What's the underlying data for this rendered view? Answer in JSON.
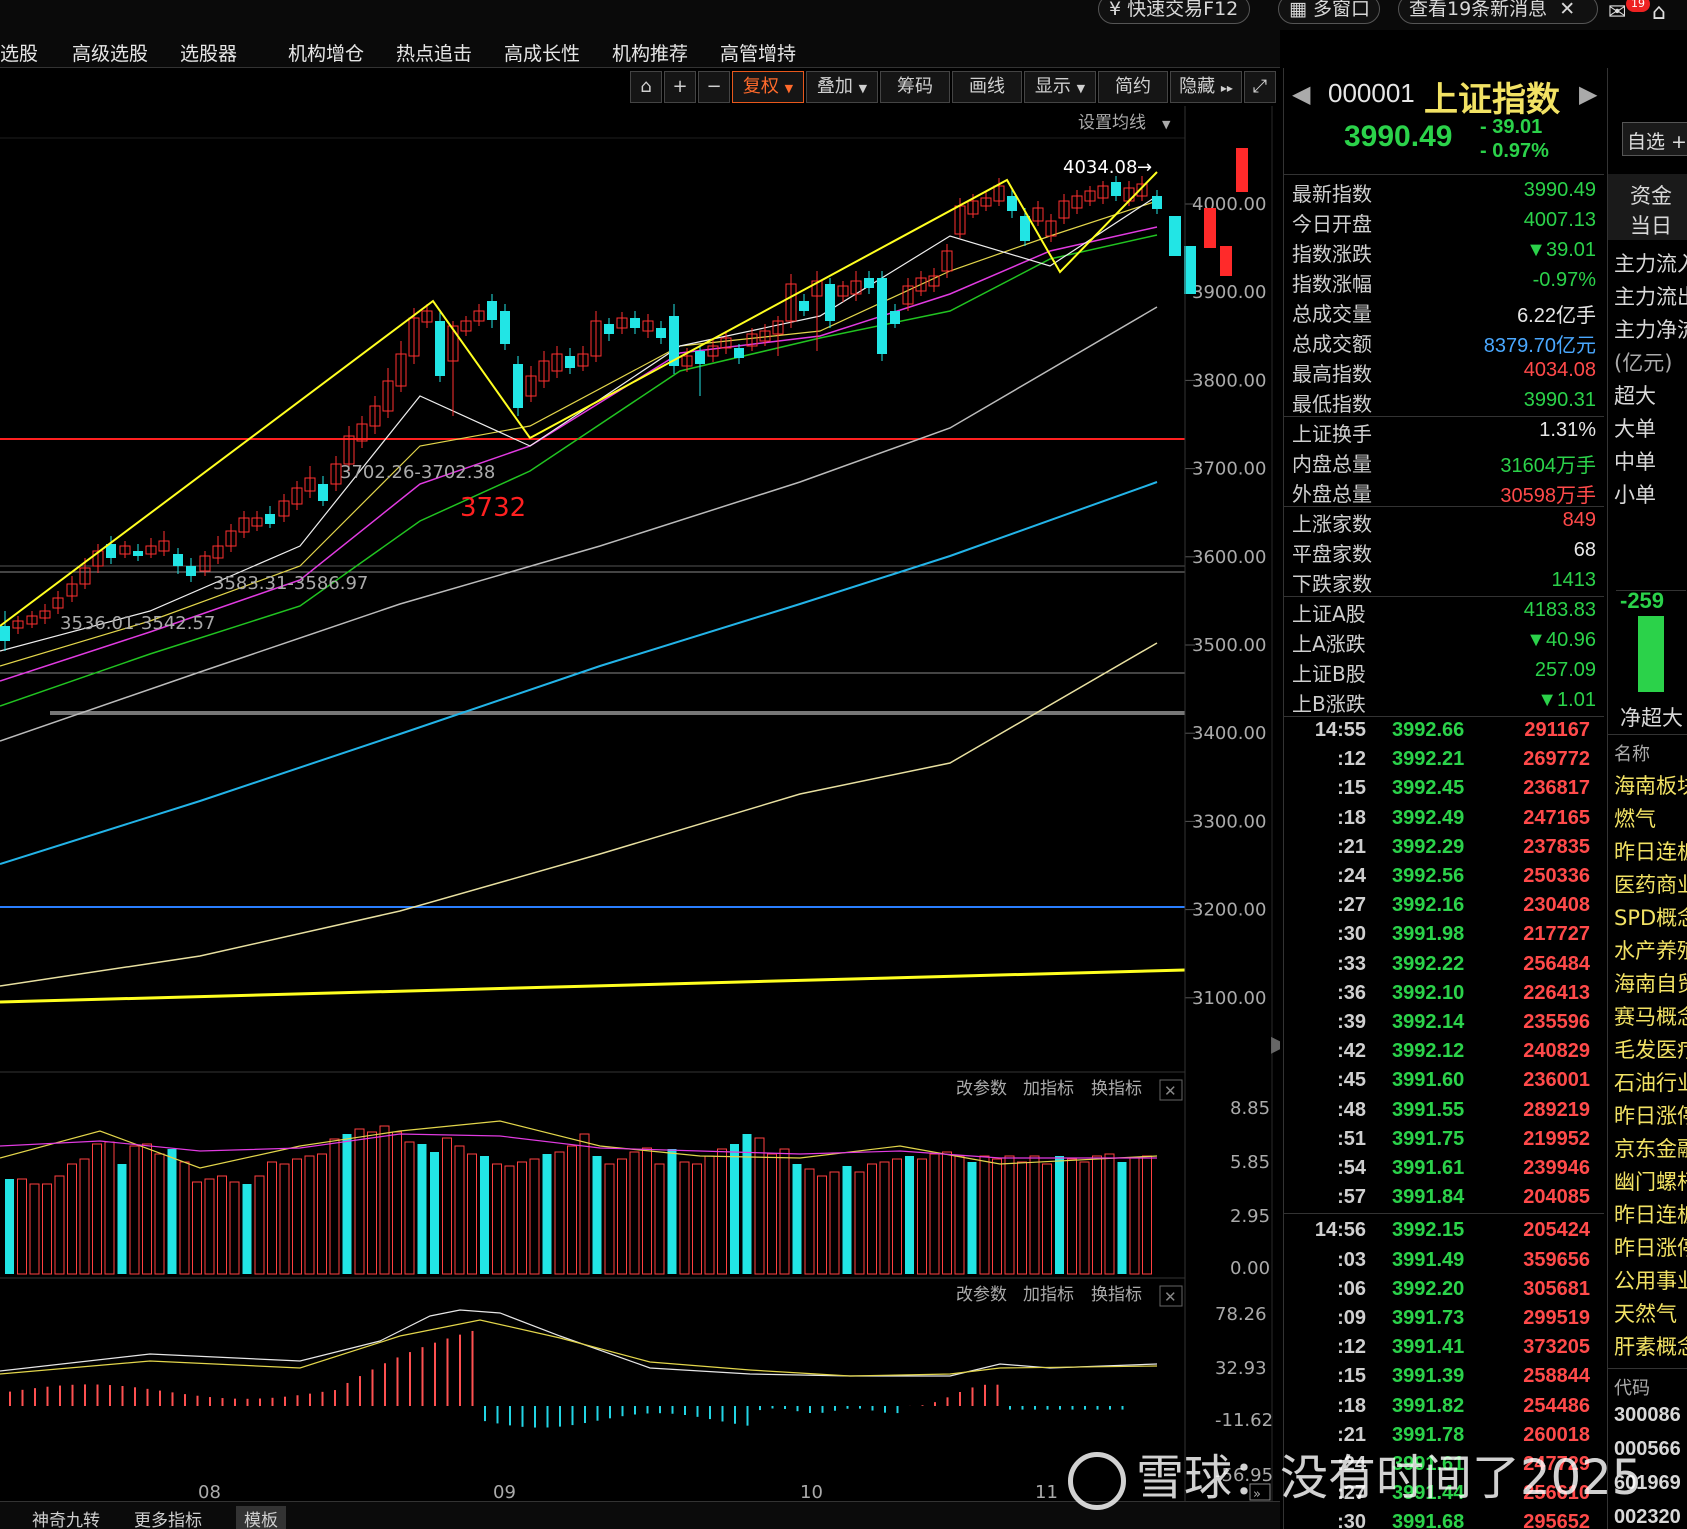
{
  "topbar": {
    "quick_trade": "快速交易F12",
    "multi_window": "多窗口",
    "news": "查看19条新消息",
    "mail_badge": "19"
  },
  "menu": [
    "选股",
    "高级选股",
    "选股器",
    "机构增仓",
    "热点追击",
    "高成长性",
    "机构推荐",
    "高管增持"
  ],
  "toolbar": {
    "restore_rights": "复权",
    "overlay": "叠加",
    "chips": "筹码",
    "draw": "画线",
    "display": "显示",
    "simple": "简约",
    "hide": "隐藏",
    "set_ma": "设置均线"
  },
  "chart": {
    "price_ticks": [
      "4000.00",
      "3900.00",
      "3800.00",
      "3700.00",
      "3600.00",
      "3500.00",
      "3400.00",
      "3300.00",
      "3200.00",
      "3100.00"
    ],
    "high_label": "4034.08",
    "annotations": {
      "a1": "3702.26-3702.38",
      "a2": "3583.31-3586.97",
      "a3": "3536.01-3542.57",
      "support": "3732"
    },
    "month_labels": [
      "08",
      "09",
      "10",
      "11"
    ],
    "volume_ticks": [
      "8.85",
      "5.85",
      "2.95",
      "0.00"
    ],
    "osc_ticks": [
      "78.26",
      "32.93",
      "-11.62",
      "-56.95"
    ],
    "panel_buttons": [
      "改参数",
      "加指标",
      "换指标"
    ]
  },
  "quote": {
    "code": "000001",
    "name": "上证指数",
    "price": "3990.49",
    "change": "- 39.01",
    "change_pct": "- 0.97%",
    "watch": "自选",
    "rows": [
      {
        "k": "最新指数",
        "v": "3990.49",
        "c": "#2bd24a"
      },
      {
        "k": "今日开盘",
        "v": "4007.13",
        "c": "#2bd24a"
      },
      {
        "k": "指数涨跌",
        "v": "▼39.01",
        "c": "#2bd24a"
      },
      {
        "k": "指数涨幅",
        "v": "-0.97%",
        "c": "#2bd24a"
      },
      {
        "k": "总成交量",
        "v": "6.22亿手",
        "c": "#e6e6e6"
      },
      {
        "k": "总成交额",
        "v": "8379.70亿元",
        "c": "#4aa8ff"
      },
      {
        "k": "最高指数",
        "v": "4034.08",
        "c": "#ff4a4a"
      },
      {
        "k": "最低指数",
        "v": "3990.31",
        "c": "#2bd24a"
      },
      {
        "k": "上证换手",
        "v": "1.31%",
        "c": "#e6e6e6"
      },
      {
        "k": "内盘总量",
        "v": "31604万手",
        "c": "#2bd24a"
      },
      {
        "k": "外盘总量",
        "v": "30598万手",
        "c": "#ff4a4a"
      },
      {
        "k": "上涨家数",
        "v": "849",
        "c": "#ff4a4a"
      },
      {
        "k": "平盘家数",
        "v": "68",
        "c": "#e6e6e6"
      },
      {
        "k": "下跌家数",
        "v": "1413",
        "c": "#2bd24a"
      },
      {
        "k": "上证A股",
        "v": "4183.83",
        "c": "#2bd24a"
      },
      {
        "k": "上A涨跌",
        "v": "▼40.96",
        "c": "#2bd24a"
      },
      {
        "k": "上证B股",
        "v": "257.09",
        "c": "#2bd24a"
      },
      {
        "k": "上B涨跌",
        "v": "▼1.01",
        "c": "#2bd24a"
      }
    ]
  },
  "ticks": [
    {
      "t": "14:55",
      "p": "3992.66",
      "q": "291167"
    },
    {
      "t": ":12",
      "p": "3992.21",
      "q": "269772"
    },
    {
      "t": ":15",
      "p": "3992.45",
      "q": "236817"
    },
    {
      "t": ":18",
      "p": "3992.49",
      "q": "247165"
    },
    {
      "t": ":21",
      "p": "3992.29",
      "q": "237835"
    },
    {
      "t": ":24",
      "p": "3992.56",
      "q": "250336"
    },
    {
      "t": ":27",
      "p": "3992.16",
      "q": "230408"
    },
    {
      "t": ":30",
      "p": "3991.98",
      "q": "217727"
    },
    {
      "t": ":33",
      "p": "3992.22",
      "q": "256484"
    },
    {
      "t": ":36",
      "p": "3992.10",
      "q": "226413"
    },
    {
      "t": ":39",
      "p": "3992.14",
      "q": "235596"
    },
    {
      "t": ":42",
      "p": "3992.12",
      "q": "240829"
    },
    {
      "t": ":45",
      "p": "3991.60",
      "q": "236001"
    },
    {
      "t": ":48",
      "p": "3991.55",
      "q": "289219"
    },
    {
      "t": ":51",
      "p": "3991.75",
      "q": "219952"
    },
    {
      "t": ":54",
      "p": "3991.61",
      "q": "239946"
    },
    {
      "t": ":57",
      "p": "3991.84",
      "q": "204085"
    },
    {
      "t": "14:56",
      "p": "3992.15",
      "q": "205424"
    },
    {
      "t": ":03",
      "p": "3991.49",
      "q": "359656"
    },
    {
      "t": ":06",
      "p": "3992.20",
      "q": "305681"
    },
    {
      "t": ":09",
      "p": "3991.73",
      "q": "299519"
    },
    {
      "t": ":12",
      "p": "3991.41",
      "q": "373205"
    },
    {
      "t": ":15",
      "p": "3991.39",
      "q": "258844"
    },
    {
      "t": ":18",
      "p": "3991.82",
      "q": "254486"
    },
    {
      "t": ":21",
      "p": "3991.78",
      "q": "260018"
    },
    {
      "t": ":24",
      "p": "3991.61",
      "q": "247729"
    },
    {
      "t": ":27",
      "p": "3991.44",
      "q": "256610"
    },
    {
      "t": ":30",
      "p": "3991.68",
      "q": "295652"
    }
  ],
  "capital": {
    "tabs": [
      "资金",
      "当日"
    ],
    "rows": [
      "主力流入",
      "主力流出",
      "主力净流",
      "(亿元)",
      "超大",
      "大单",
      "中单",
      "小单"
    ],
    "net_value": "-259",
    "net_label": "净超大",
    "name_header": "名称",
    "sectors": [
      "海南板块",
      "燃气",
      "昨日连板",
      "医药商业",
      "SPD概念",
      "水产养殖",
      "海南自贸",
      "赛马概念",
      "毛发医疗",
      "石油行业",
      "昨日涨停",
      "京东金融",
      "幽门螺杆",
      "昨日连板",
      "昨日涨停",
      "公用事业",
      "天然气",
      "肝素概念"
    ],
    "code_header": "代码",
    "codes": [
      "300086",
      "000566",
      "601969",
      "002320"
    ]
  },
  "bottom": {
    "tabs": [
      "神奇九转",
      "更多指标",
      "模板"
    ]
  },
  "watermark": {
    "brand": "雪球",
    "author": "没有时间了2025"
  }
}
